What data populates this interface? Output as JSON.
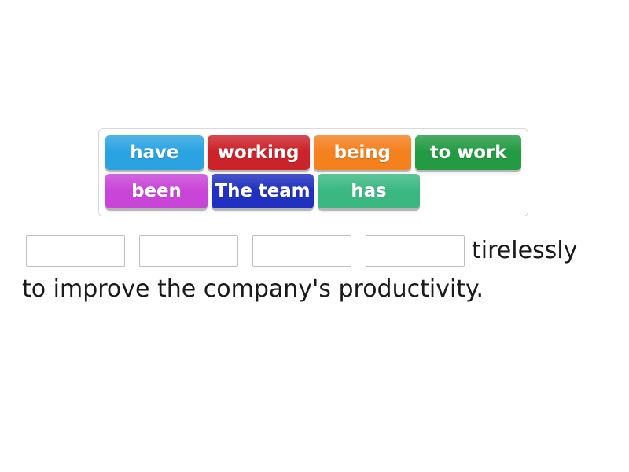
{
  "exercise": {
    "type": "sentence-builder-drag-drop",
    "tile_pool": {
      "rows": [
        [
          {
            "label": "have",
            "color": "#2ba3e3"
          },
          {
            "label": "working",
            "color": "#cc2229"
          },
          {
            "label": "being",
            "color": "#f5801e"
          },
          {
            "label": "to work",
            "color": "#239b43"
          }
        ],
        [
          {
            "label": "been",
            "color": "#c945d8"
          },
          {
            "label": "The team",
            "color": "#2030c0"
          },
          {
            "label": "has",
            "color": "#3bb882"
          }
        ]
      ]
    },
    "sentence": {
      "blanks": [
        {
          "value": "",
          "placeholder": ""
        },
        {
          "value": "",
          "placeholder": ""
        },
        {
          "value": "",
          "placeholder": ""
        },
        {
          "value": "",
          "placeholder": ""
        }
      ],
      "trailing_word": "tirelessly",
      "line2": "to improve the company's productivity."
    }
  }
}
